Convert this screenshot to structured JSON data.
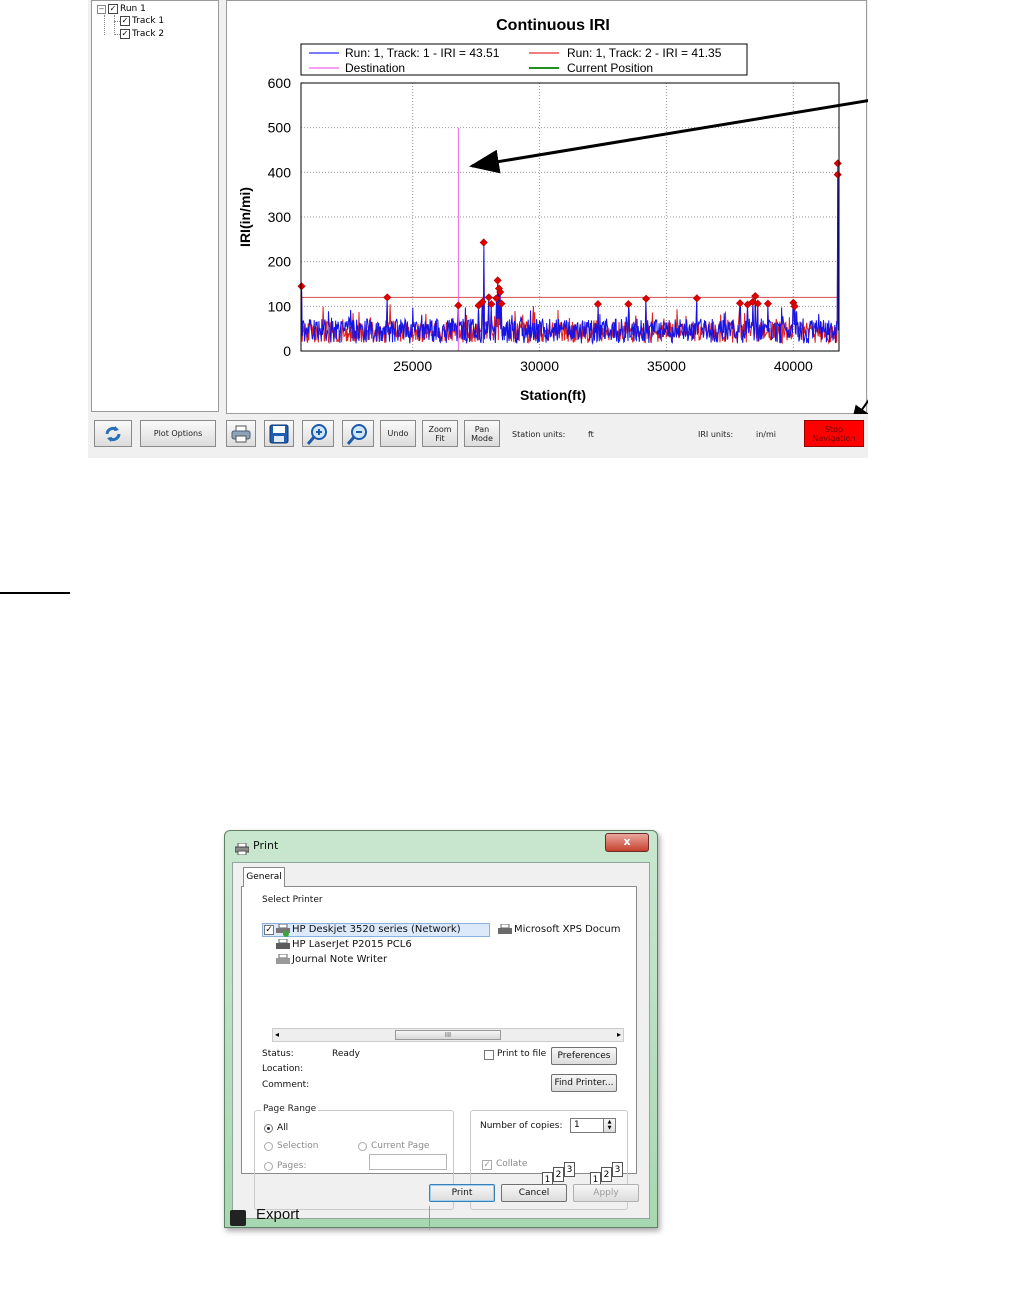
{
  "app": {
    "tree": {
      "expander": "−",
      "check_mark": "✓",
      "items": [
        {
          "label": "Run 1"
        },
        {
          "label": "Track 1"
        },
        {
          "label": "Track 2"
        }
      ]
    },
    "toolbar": {
      "refresh_icon": "refresh-icon",
      "plot_options_label": "Plot Options",
      "print_icon": "printer-icon",
      "save_icon": "floppy-disk-icon",
      "zoom_in_icon": "zoom-in-icon",
      "zoom_out_icon": "zoom-out-icon",
      "undo_label": "Undo",
      "zoom_fit_label": "Zoom Fit",
      "pan_mode_label": "Pan Mode",
      "station_units_label": "Station units:",
      "station_units_value": "ft",
      "iri_units_label": "IRI units:",
      "iri_units_value": "in/mi",
      "stop_navigation_label": "Stop Navigation",
      "stop_navigation_color": "#ff0000"
    }
  },
  "chart_data": {
    "type": "line",
    "title": "Continuous IRI",
    "xlabel": "Station(ft)",
    "ylabel": "IRI(in/mi)",
    "xlim": [
      20600,
      41800
    ],
    "ylim": [
      0,
      600
    ],
    "xticks": [
      25000,
      30000,
      35000,
      40000
    ],
    "yticks": [
      0,
      100,
      200,
      300,
      400,
      500,
      600
    ],
    "grid": true,
    "legend_placement": "top",
    "threshold": 120,
    "legend": [
      {
        "name": "Run: 1, Track: 1 - IRI = 43.51",
        "color": "#2a2aff"
      },
      {
        "name": "Run: 1, Track: 2 - IRI = 41.35",
        "color": "#e83232"
      },
      {
        "name": "Destination",
        "color": "#ee66ee"
      },
      {
        "name": "Current Position",
        "color": "#008000"
      }
    ],
    "series": [
      {
        "name": "Run: 1, Track: 1 - IRI = 43.51",
        "color": "#1414e6",
        "baseline": 45,
        "amplitude": 28
      },
      {
        "name": "Run: 1, Track: 2 - IRI = 41.35",
        "color": "#e02020",
        "baseline": 42,
        "amplitude": 24
      }
    ],
    "destination_line": {
      "x": 26800,
      "ymax": 500
    },
    "peaks": [
      {
        "x": 20620,
        "y": 145
      },
      {
        "x": 24000,
        "y": 120
      },
      {
        "x": 26800,
        "y": 102
      },
      {
        "x": 27600,
        "y": 102
      },
      {
        "x": 27750,
        "y": 110
      },
      {
        "x": 27800,
        "y": 243
      },
      {
        "x": 28000,
        "y": 120
      },
      {
        "x": 28100,
        "y": 105
      },
      {
        "x": 28300,
        "y": 118
      },
      {
        "x": 28350,
        "y": 158
      },
      {
        "x": 28400,
        "y": 140
      },
      {
        "x": 28450,
        "y": 132
      },
      {
        "x": 28500,
        "y": 106
      },
      {
        "x": 32300,
        "y": 105
      },
      {
        "x": 33500,
        "y": 105
      },
      {
        "x": 34200,
        "y": 117
      },
      {
        "x": 36200,
        "y": 118
      },
      {
        "x": 37900,
        "y": 107
      },
      {
        "x": 38200,
        "y": 104
      },
      {
        "x": 38400,
        "y": 110
      },
      {
        "x": 38500,
        "y": 123
      },
      {
        "x": 38600,
        "y": 106
      },
      {
        "x": 39000,
        "y": 106
      },
      {
        "x": 40000,
        "y": 108
      },
      {
        "x": 40050,
        "y": 100
      },
      {
        "x": 41750,
        "y": 420
      },
      {
        "x": 41750,
        "y": 395
      }
    ]
  },
  "print_dialog": {
    "title": "Print",
    "close_glyph": "x",
    "tab_general": "General",
    "select_printer_label": "Select Printer",
    "printers": [
      {
        "name": "HP Deskjet 3520 series (Network)"
      },
      {
        "name": "HP LaserJet P2015 PCL6"
      },
      {
        "name": "Journal Note Writer"
      },
      {
        "name": "Microsoft XPS Docum"
      }
    ],
    "scroll_thumb": "III",
    "status_label": "Status:",
    "status_value": "Ready",
    "location_label": "Location:",
    "comment_label": "Comment:",
    "print_to_file_label": "Print to file",
    "preferences_label": "Preferences",
    "find_printer_label": "Find Printer...",
    "page_range_label": "Page Range",
    "all_label": "All",
    "selection_label": "Selection",
    "current_page_label": "Current Page",
    "pages_label": "Pages:",
    "number_of_copies_label": "Number of copies:",
    "copies_value": "1",
    "collate_label": "Collate",
    "collate_digits": [
      "1",
      "2",
      "3"
    ],
    "print_button": "Print",
    "cancel_button": "Cancel",
    "apply_button": "Apply",
    "background_text": "Export"
  }
}
